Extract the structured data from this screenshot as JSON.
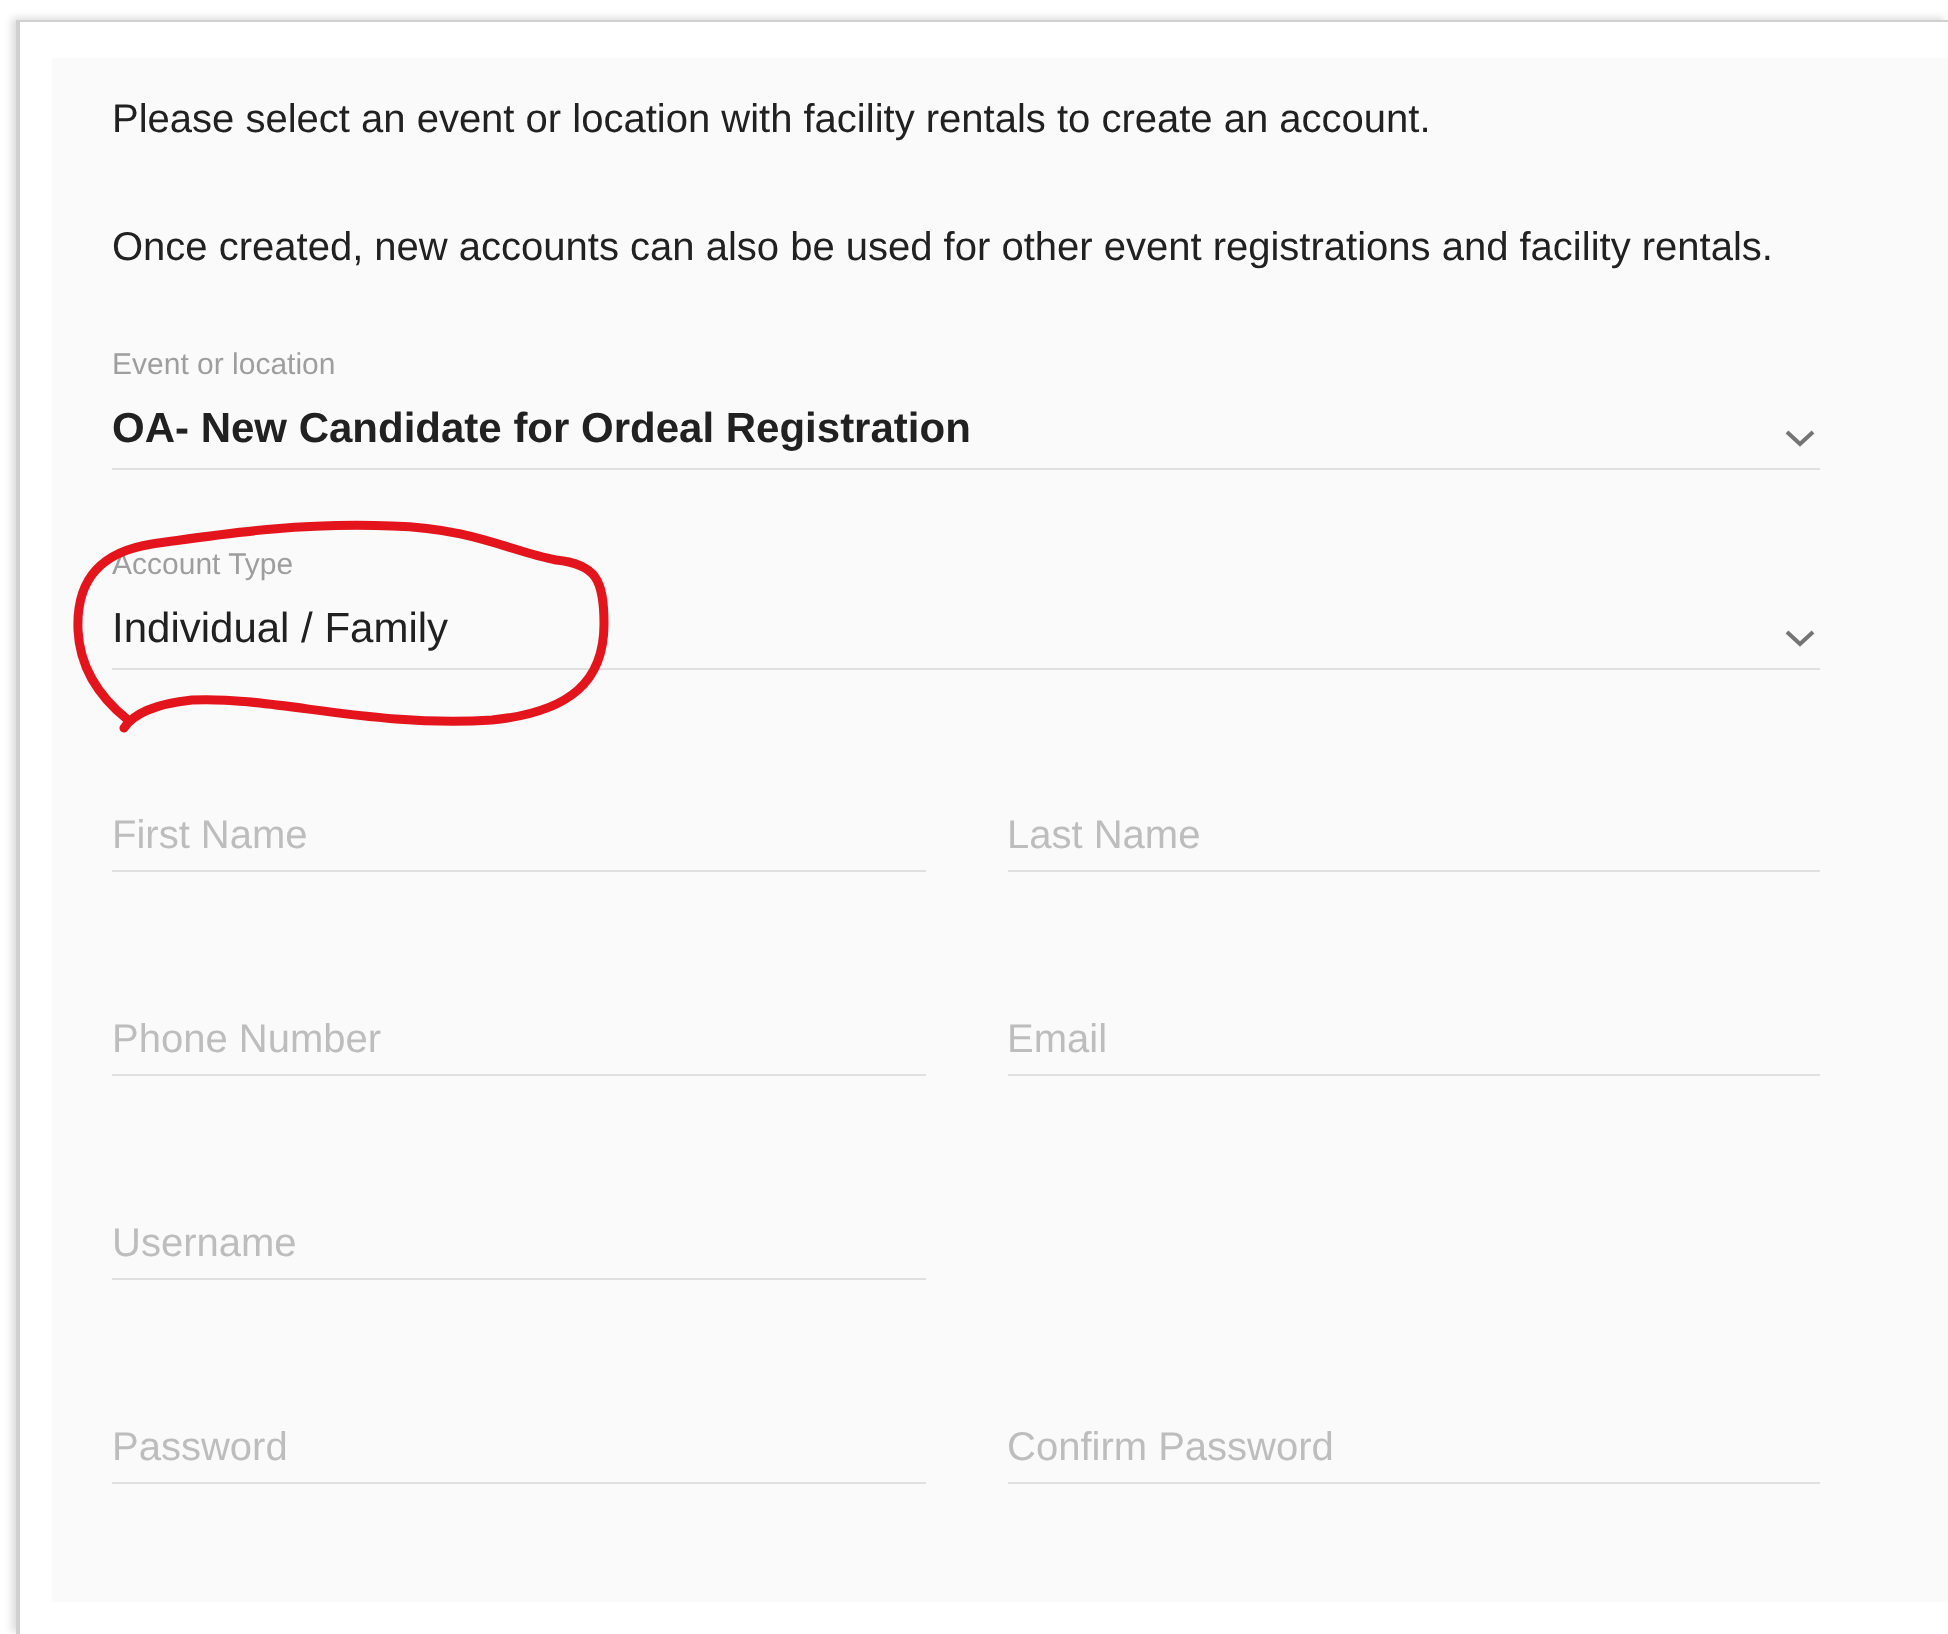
{
  "intro": [
    "Please select an event or location with facility rentals to create an account.",
    "Once created, new accounts can also be used for other event registrations and facility rentals."
  ],
  "selects": [
    {
      "label": "Event or location",
      "value": "OA- New Candidate for Ordeal Registration",
      "bold": true,
      "annotated": false
    },
    {
      "label": "Account Type",
      "value": "Individual / Family",
      "bold": false,
      "annotated": true
    }
  ],
  "field_rows": [
    [
      {
        "placeholder": "First Name"
      },
      {
        "placeholder": "Last Name"
      }
    ],
    [
      {
        "placeholder": "Phone Number"
      },
      {
        "placeholder": "Email"
      }
    ],
    [
      {
        "placeholder": "Username"
      }
    ],
    [
      {
        "placeholder": "Password"
      },
      {
        "placeholder": "Confirm Password"
      }
    ]
  ]
}
